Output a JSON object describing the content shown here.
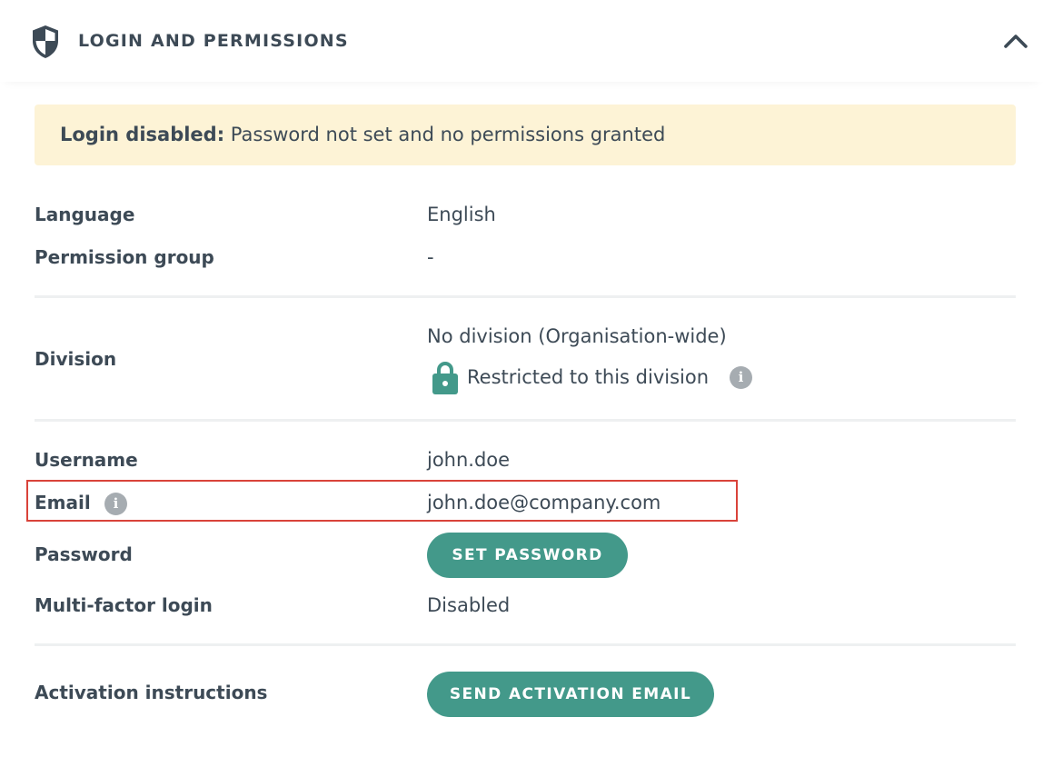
{
  "section": {
    "title": "LOGIN AND PERMISSIONS",
    "shield_icon": "shield-icon",
    "collapse_icon": "chevron-up-icon"
  },
  "alert": {
    "bold": "Login disabled:",
    "text": " Password not set and no permissions granted",
    "background": "#fdf3d6"
  },
  "fields": {
    "language": {
      "label": "Language",
      "value": "English"
    },
    "permission_group": {
      "label": "Permission group",
      "value": "-"
    },
    "division": {
      "label": "Division",
      "value": "No division (Organisation-wide)",
      "restriction": "Restricted to this division"
    },
    "username": {
      "label": "Username",
      "value": "john.doe"
    },
    "email": {
      "label": "Email",
      "value": "john.doe@company.com"
    },
    "password": {
      "label": "Password",
      "button": "SET PASSWORD"
    },
    "mfa": {
      "label": "Multi-factor login",
      "value": "Disabled"
    },
    "activation": {
      "label": "Activation instructions",
      "button": "SEND ACTIVATION EMAIL"
    }
  },
  "colors": {
    "accent": "#43998a",
    "text": "#3d4a56",
    "info_icon": "#a6acb1",
    "highlight": "#d9433a"
  }
}
